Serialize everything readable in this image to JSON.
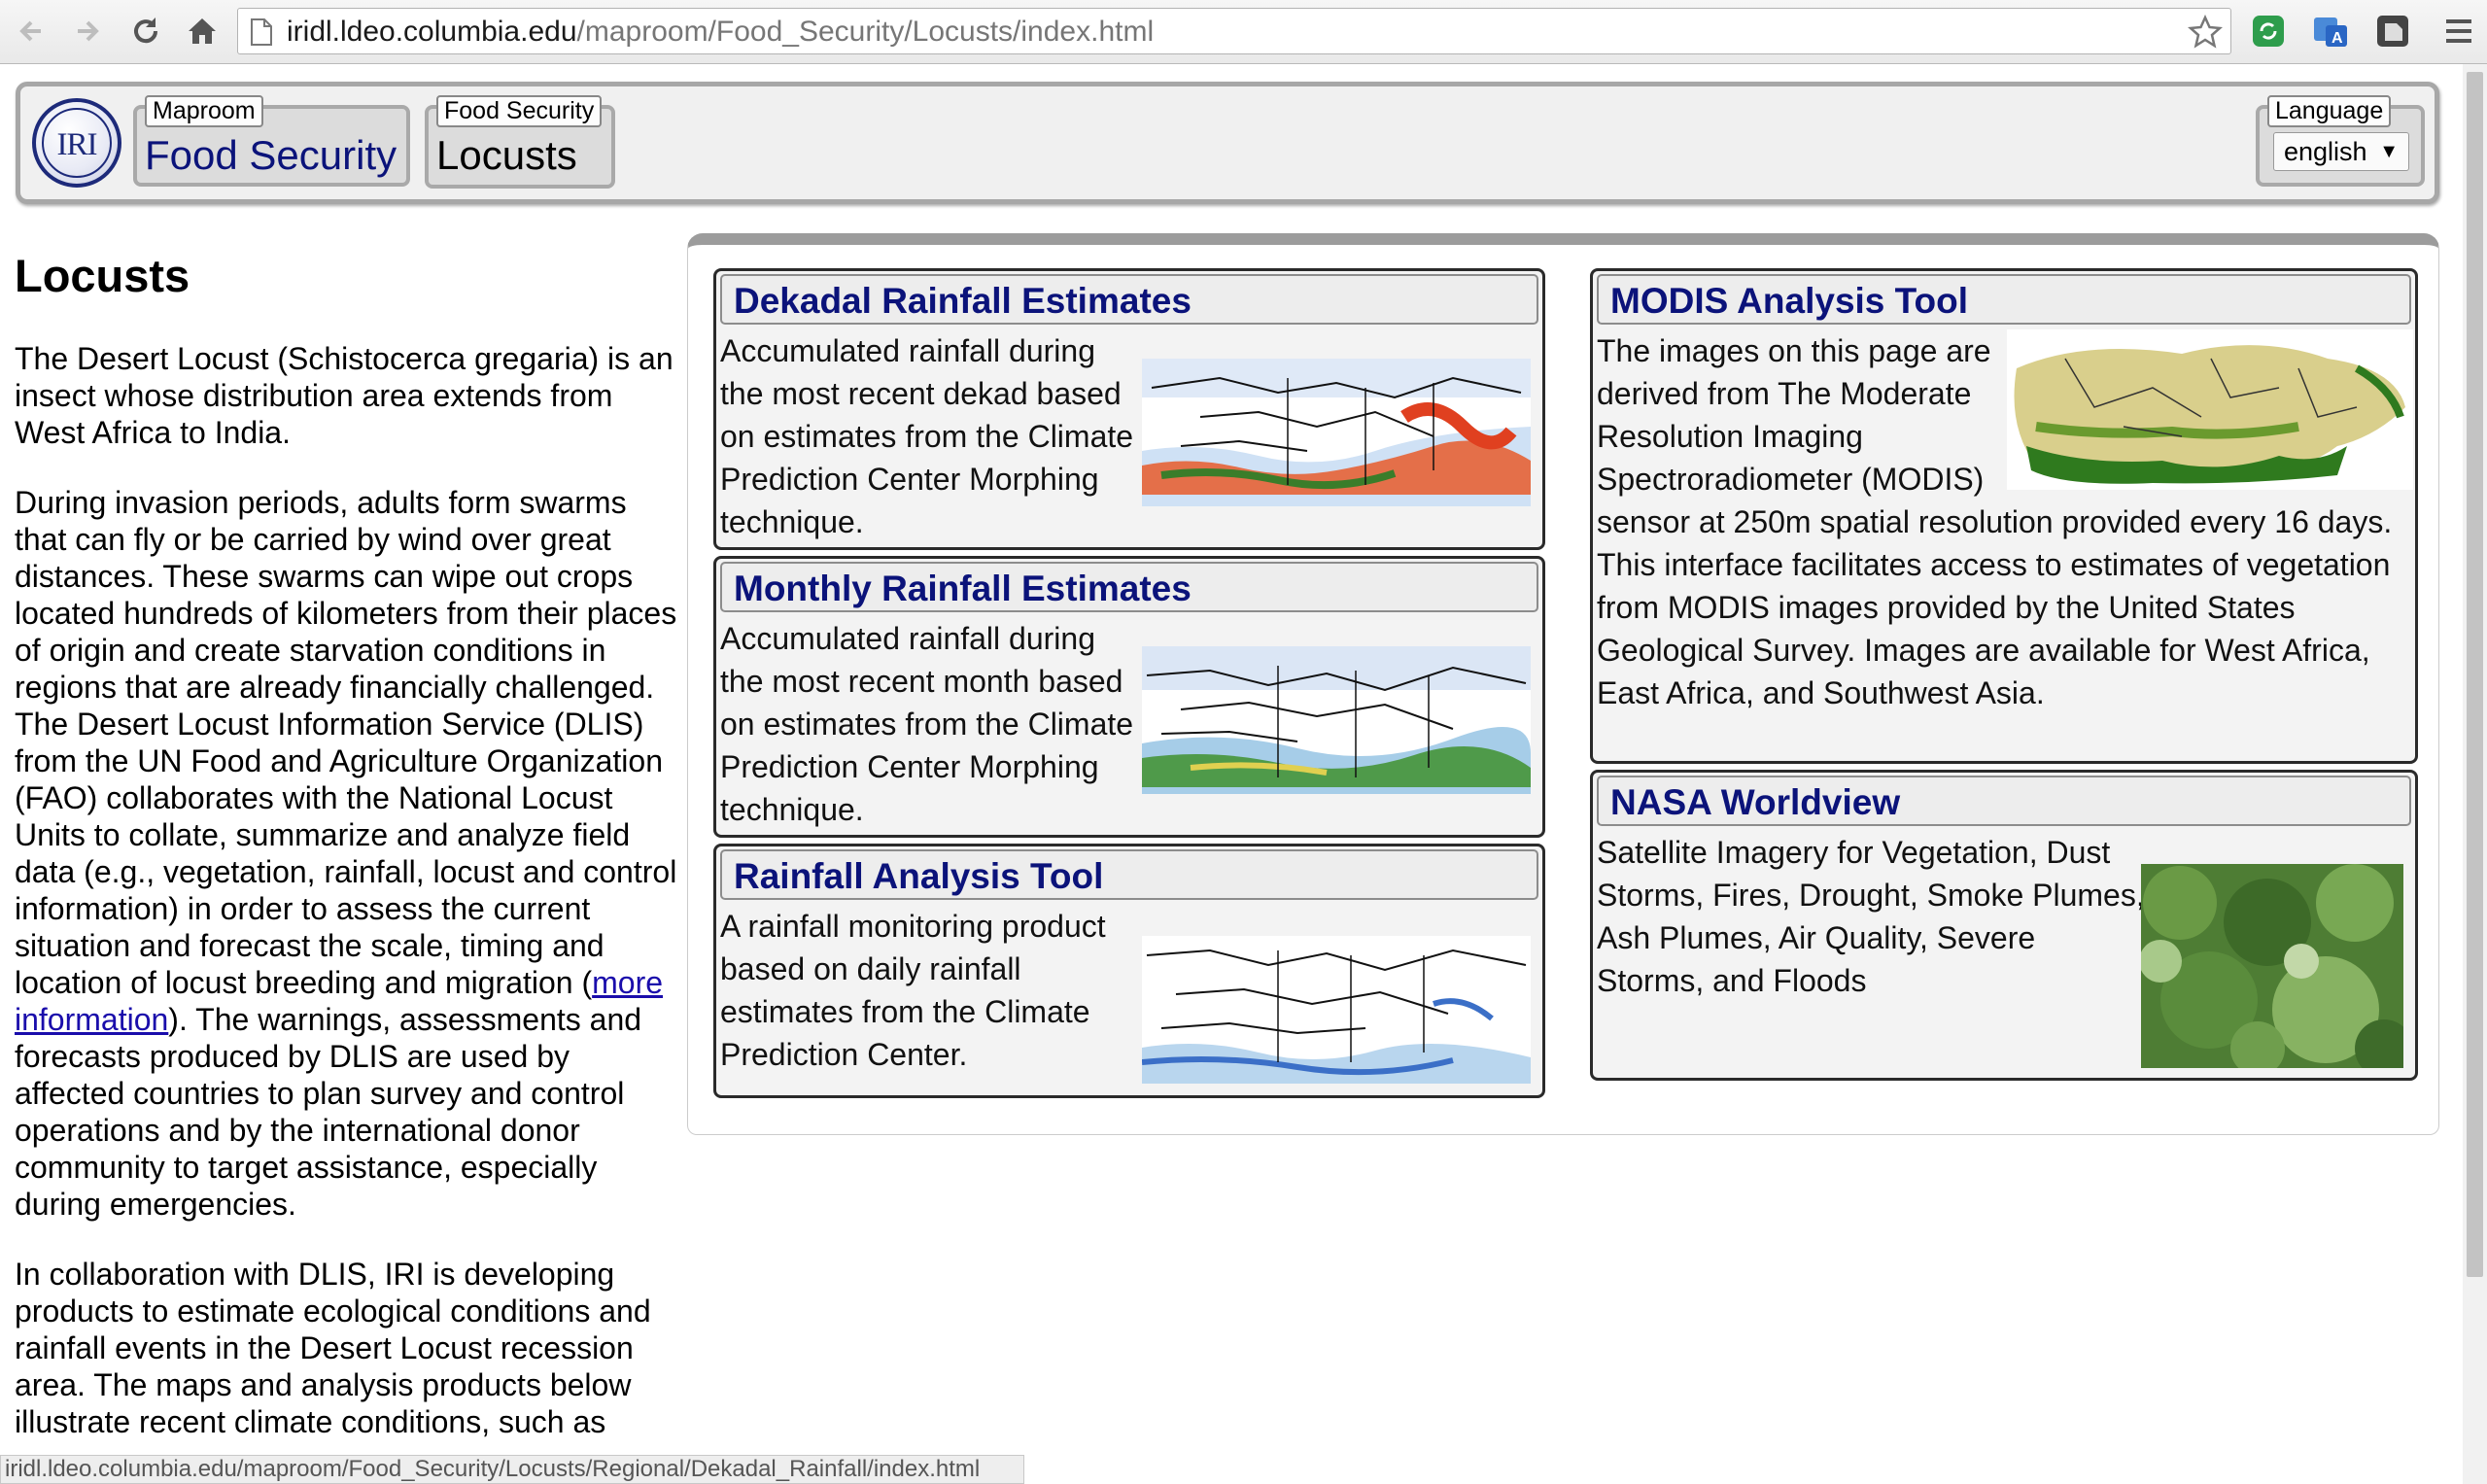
{
  "browser": {
    "url_host": "iridl.ldeo.columbia.edu",
    "url_path": "/maproom/Food_Security/Locusts/index.html",
    "status_url": "iridl.ldeo.columbia.edu/maproom/Food_Security/Locusts/Regional/Dekadal_Rainfall/index.html"
  },
  "header": {
    "logo_text": "IRI",
    "crumbs": [
      {
        "caption": "Maproom",
        "label": "Food Security"
      },
      {
        "caption": "Food Security",
        "label": "Locusts"
      }
    ],
    "language": {
      "caption": "Language",
      "value": "english"
    }
  },
  "article": {
    "title": "Locusts",
    "p1": "The Desert Locust (Schistocerca gregaria) is an insect whose distribution area extends from West Africa to India.",
    "p2_before": "During invasion periods, adults form swarms that can fly or be carried by wind over great distances. These swarms can wipe out crops located hundreds of kilometers from their places of origin and create starvation conditions in regions that are already financially challenged. The Desert Locust Information Service (DLIS) from the UN Food and Agriculture Organization (FAO) collaborates with the National Locust Units to collate, summarize and analyze field data (e.g., vegetation, rainfall, locust and control information) in order to assess the current situation and forecast the scale, timing and location of locust breeding and migration (",
    "p2_link": "more information",
    "p2_after": "). The warnings, assessments and forecasts produced by DLIS are used by affected countries to plan survey and control operations and by the international donor community to target assistance, especially during emergencies.",
    "p3": "In collaboration with DLIS, IRI is developing products to estimate ecological conditions and rainfall events in the Desert Locust recession area. The maps and analysis products below illustrate recent climate conditions, such as"
  },
  "cards": {
    "dekadal": {
      "title": "Dekadal Rainfall Estimates",
      "text": "Accumulated rainfall during the most recent dekad based on estimates from the Climate Prediction Center Morphing technique."
    },
    "monthly": {
      "title": "Monthly Rainfall Estimates",
      "text": "Accumulated rainfall during the most recent month based on estimates from the Climate Prediction Center Morphing technique."
    },
    "rainfall_tool": {
      "title": "Rainfall Analysis Tool",
      "text": "A rainfall monitoring product based on daily rainfall estimates from the Climate Prediction Center."
    },
    "modis": {
      "title": "MODIS Analysis Tool",
      "text": "The images on this page are derived from The Moderate Resolution Imaging Spectroradiometer (MODIS) sensor at 250m spatial resolution provided every 16 days. This interface facilitates access to estimates of vegetation from MODIS images provided by the United States Geological Survey. Images are available for West Africa, East Africa, and Southwest Asia."
    },
    "nasa": {
      "title": "NASA Worldview",
      "text": "Satellite Imagery for Vegetation, Dust Storms, Fires, Drought, Smoke Plumes, Ash Plumes, Air Quality, Severe Storms, and Floods"
    }
  },
  "colors": {
    "link_title": "#0b137a",
    "link": "#1a0dab",
    "frame": "#a7a7a7"
  }
}
